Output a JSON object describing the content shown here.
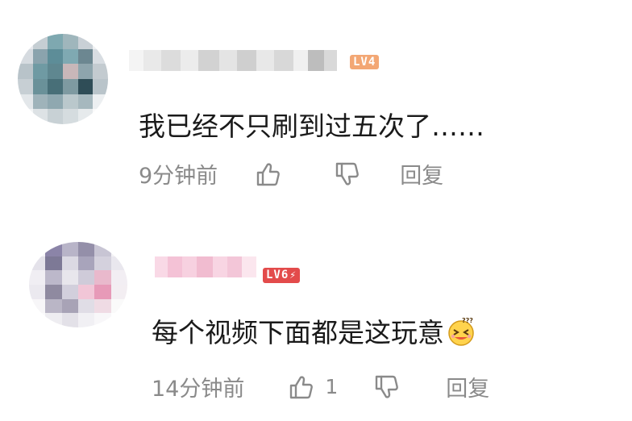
{
  "comments": [
    {
      "username": "",
      "level": "LV4",
      "content": "我已经不只刷到过五次了……",
      "time": "9分钟前",
      "likes": "",
      "reply_label": "回复"
    },
    {
      "username": "",
      "level": "LV6",
      "content": "每个视频下面都是这玩意",
      "time": "14分钟前",
      "likes": "1",
      "reply_label": "回复"
    }
  ],
  "colors": {
    "lv4_badge": "#f3a774",
    "lv6_badge": "#e34b4b",
    "meta_text": "#8a8a8a",
    "content_text": "#1a1a1a"
  },
  "icons": [
    "thumbs-up-icon",
    "thumbs-down-icon",
    "lightning-icon",
    "emoji-squint-icon"
  ]
}
